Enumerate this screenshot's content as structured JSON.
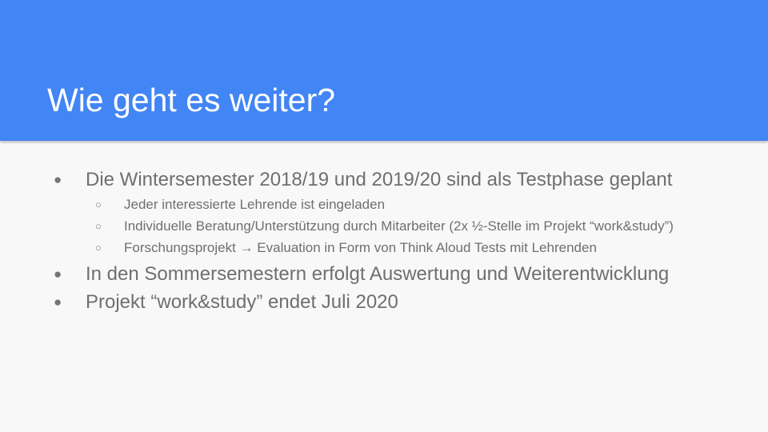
{
  "slide": {
    "title": "Wie geht es weiter?",
    "colors": {
      "header_background": "#4285f4",
      "body_background": "#f8f8f8",
      "title_text": "#ffffff",
      "body_text": "#6f6f6f"
    },
    "bullets": [
      {
        "text": "Die Wintersemester 2018/19 und 2019/20 sind als Testphase geplant",
        "marker": "●",
        "sub": [
          {
            "text": "Jeder interessierte Lehrende ist eingeladen",
            "marker": "○"
          },
          {
            "text": "Individuelle Beratung/Unterstützung durch Mitarbeiter (2x ½-Stelle im Projekt “work&study”)",
            "marker": "○"
          },
          {
            "text": "Forschungsprojekt → Evaluation in Form von Think Aloud Tests mit Lehrenden",
            "marker": "○"
          }
        ]
      },
      {
        "text": "In den Sommersemestern erfolgt Auswertung und Weiterentwicklung",
        "marker": "●",
        "sub": []
      },
      {
        "text": "Projekt “work&study” endet Juli 2020",
        "marker": "●",
        "sub": []
      }
    ]
  }
}
